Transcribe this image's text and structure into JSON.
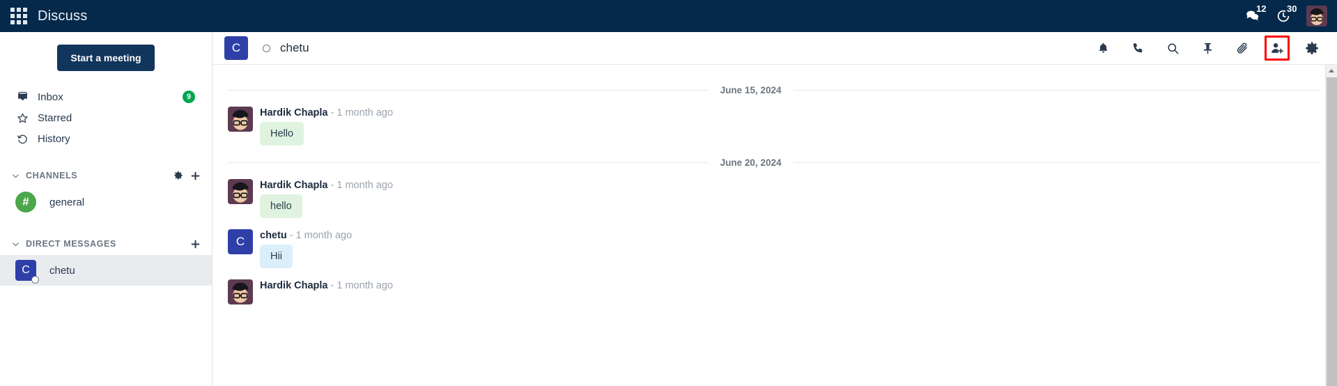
{
  "navbar": {
    "apps_icon": "apps-grid-icon",
    "brand": "Discuss",
    "messages_icon": "messages-icon",
    "messages_count": "12",
    "activity_icon": "activity-clock-icon",
    "activity_count": "30",
    "avatar": "user-avatar"
  },
  "sidebar": {
    "start_meeting_label": "Start a meeting",
    "nav_items": [
      {
        "label": "Inbox",
        "icon": "inbox-icon",
        "badge": "9"
      },
      {
        "label": "Starred",
        "icon": "star-icon",
        "badge": ""
      },
      {
        "label": "History",
        "icon": "history-icon",
        "badge": ""
      }
    ],
    "channels_section": {
      "title": "CHANNELS",
      "gear_icon": "gear-icon",
      "add_icon": "plus-icon",
      "items": [
        {
          "label": "general",
          "avatar_text": "#",
          "avatar_color": "#4ca64c",
          "active": false
        }
      ]
    },
    "dm_section": {
      "title": "DIRECT MESSAGES",
      "add_icon": "plus-icon",
      "items": [
        {
          "label": "chetu",
          "avatar_text": "C",
          "avatar_color": "#2f3fa8",
          "active": true
        }
      ]
    }
  },
  "chat": {
    "header": {
      "avatar_text": "C",
      "title": "chetu",
      "status": "offline",
      "actions": [
        {
          "name": "notification-bell-icon",
          "label": "Notification Settings"
        },
        {
          "name": "phone-icon",
          "label": "Start a Call"
        },
        {
          "name": "search-icon",
          "label": "Search Messages"
        },
        {
          "name": "pin-icon",
          "label": "Pinned Messages"
        },
        {
          "name": "paperclip-icon",
          "label": "Attachments"
        },
        {
          "name": "add-user-icon",
          "label": "Add Users"
        },
        {
          "name": "gear-icon",
          "label": "Thread Settings"
        }
      ],
      "highlighted_action": "add-user-icon",
      "highlight_color": "#ff0000"
    },
    "groups": [
      {
        "date": "June 15, 2024",
        "messages": [
          {
            "author": "Hardik Chapla",
            "time": "- 1 month ago",
            "text": "Hello",
            "bubble": "green",
            "avatar_type": "photo",
            "avatar_text": ""
          }
        ]
      },
      {
        "date": "June 20, 2024",
        "messages": [
          {
            "author": "Hardik Chapla",
            "time": "- 1 month ago",
            "text": "hello",
            "bubble": "green",
            "avatar_type": "photo",
            "avatar_text": ""
          },
          {
            "author": "chetu",
            "time": "- 1 month ago",
            "text": "Hii",
            "bubble": "blue",
            "avatar_type": "letter",
            "avatar_text": "C"
          },
          {
            "author": "Hardik Chapla",
            "time": "- 1 month ago",
            "text": "",
            "bubble": "green",
            "avatar_type": "photo",
            "avatar_text": ""
          }
        ]
      }
    ]
  },
  "colors": {
    "navbar_bg": "#05294b",
    "accent_blue": "#2f3fa8",
    "badge_green": "#00a54f",
    "bubble_green": "#dff3e0",
    "bubble_blue": "#dbeffa"
  }
}
